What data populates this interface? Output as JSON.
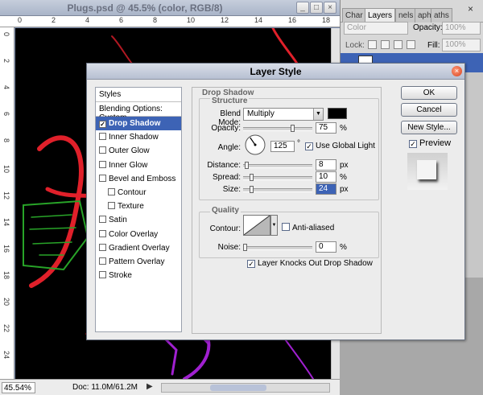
{
  "document": {
    "title": "Plugs.psd @ 45.5% (color, RGB/8)",
    "minimize": "_",
    "maximize": "□",
    "close": "×",
    "zoom": "45.54%",
    "doc_info": "Doc: 11.0M/61.2M",
    "status_arrow": "▶",
    "ruler_top": [
      "0",
      "2",
      "4",
      "6",
      "8",
      "10",
      "12",
      "14",
      "16",
      "18"
    ],
    "ruler_left": [
      "0",
      "2",
      "4",
      "6",
      "8",
      "10",
      "12",
      "14",
      "16",
      "18",
      "20",
      "22",
      "24"
    ]
  },
  "layers_panel": {
    "tabs": [
      "Char",
      "Layers",
      "nels",
      "aph",
      "aths"
    ],
    "active_tab": "Layers",
    "close": "×",
    "blend_mode": "Color",
    "opacity_label": "Opacity:",
    "opacity_value": "100%",
    "lock_label": "Lock:",
    "fill_label": "Fill:",
    "fill_value": "100%"
  },
  "dialog": {
    "title": "Layer Style",
    "close": "×",
    "styles_header": "Styles",
    "blending_options": "Blending Options: Custom",
    "style_items": [
      {
        "label": "Drop Shadow",
        "checked": true,
        "selected": true,
        "indent": false
      },
      {
        "label": "Inner Shadow",
        "checked": false,
        "selected": false,
        "indent": false
      },
      {
        "label": "Outer Glow",
        "checked": false,
        "selected": false,
        "indent": false
      },
      {
        "label": "Inner Glow",
        "checked": false,
        "selected": false,
        "indent": false
      },
      {
        "label": "Bevel and Emboss",
        "checked": false,
        "selected": false,
        "indent": false
      },
      {
        "label": "Contour",
        "checked": false,
        "selected": false,
        "indent": true
      },
      {
        "label": "Texture",
        "checked": false,
        "selected": false,
        "indent": true
      },
      {
        "label": "Satin",
        "checked": false,
        "selected": false,
        "indent": false
      },
      {
        "label": "Color Overlay",
        "checked": false,
        "selected": false,
        "indent": false
      },
      {
        "label": "Gradient Overlay",
        "checked": false,
        "selected": false,
        "indent": false
      },
      {
        "label": "Pattern Overlay",
        "checked": false,
        "selected": false,
        "indent": false
      },
      {
        "label": "Stroke",
        "checked": false,
        "selected": false,
        "indent": false
      }
    ],
    "drop_shadow": {
      "title": "Drop Shadow",
      "structure_title": "Structure",
      "blend_mode_label": "Blend Mode:",
      "blend_mode": "Multiply",
      "shadow_color": "#000000",
      "opacity_label": "Opacity:",
      "opacity": "75",
      "opacity_fraction": 0.75,
      "percent": "%",
      "angle_label": "Angle:",
      "angle": "125",
      "angle_deg": 125,
      "degree": "°",
      "use_global_light": "Use Global Light",
      "use_global_light_checked": true,
      "distance_label": "Distance:",
      "distance": "8",
      "distance_fraction": 0.03,
      "spread_label": "Spread:",
      "spread": "10",
      "spread_fraction": 0.1,
      "size_label": "Size:",
      "size": "24",
      "size_fraction": 0.1,
      "px": "px",
      "quality_title": "Quality",
      "contour_label": "Contour:",
      "anti_aliased": "Anti-aliased",
      "anti_aliased_checked": false,
      "noise_label": "Noise:",
      "noise": "0",
      "noise_fraction": 0,
      "knocks_out": "Layer Knocks Out Drop Shadow",
      "knocks_out_checked": true
    },
    "buttons": {
      "ok": "OK",
      "cancel": "Cancel",
      "new_style": "New Style..."
    },
    "preview_label": "Preview",
    "preview_checked": true
  },
  "colors": {
    "selection": "#3d63b5",
    "canvas": "#000000",
    "neon_red": "#e0202a",
    "neon_green": "#28a428",
    "neon_purple": "#a020d0"
  }
}
